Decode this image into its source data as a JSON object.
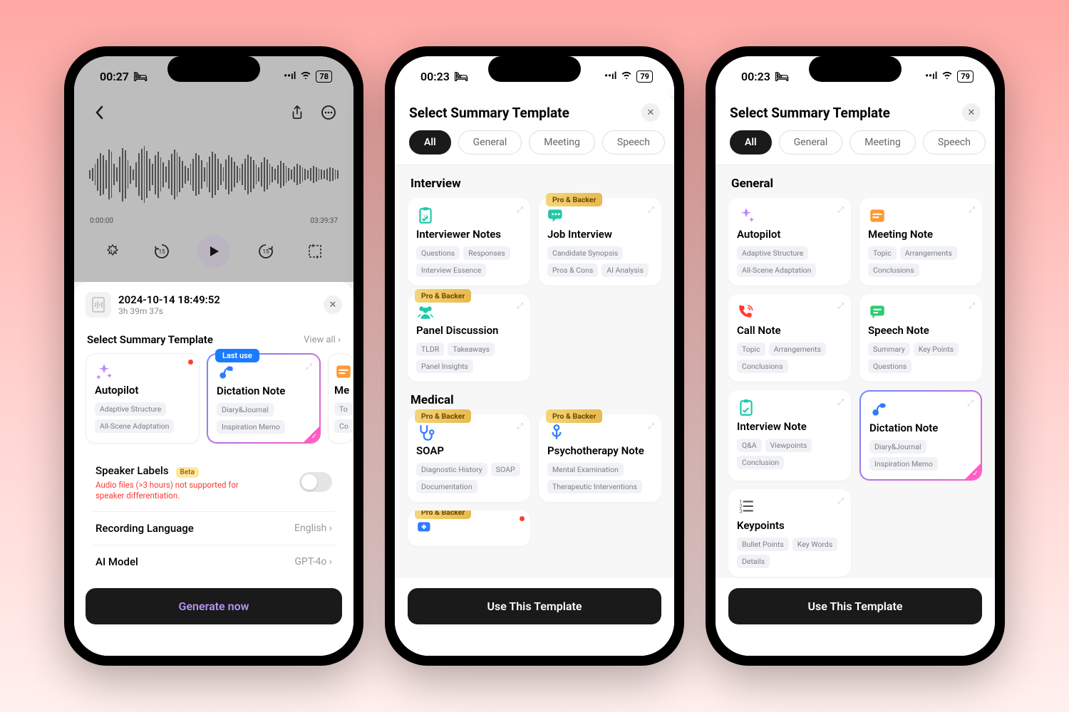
{
  "status": {
    "time1": "00:27",
    "time2": "00:23",
    "battery1": "78",
    "battery2": "79"
  },
  "phone1": {
    "waveform_start": "0:00:00",
    "waveform_end": "03:39:37",
    "rec_title": "2024-10-14 18:49:52",
    "rec_duration": "3h 39m 37s",
    "section": "Select Summary Template",
    "view_all": "View all",
    "autopilot": {
      "name": "Autopilot",
      "tag1": "Adaptive Structure",
      "tag2": "All-Scene Adaptation"
    },
    "dictation": {
      "badge": "Last use",
      "name": "Dictation Note",
      "tag1": "Diary&Journal",
      "tag2": "Inspiration Memo"
    },
    "meeting_cut": {
      "name": "Me",
      "tag1": "To",
      "tag2": "Co"
    },
    "speaker": {
      "label": "Speaker Labels",
      "beta": "Beta",
      "warn": "Audio files (>3 hours) not supported for speaker differentiation."
    },
    "lang": {
      "label": "Recording Language",
      "value": "English"
    },
    "model": {
      "label": "AI Model",
      "value": "GPT-4o"
    },
    "cta": "Generate now"
  },
  "sheet_common": {
    "title": "Select Summary Template",
    "pills": {
      "all": "All",
      "general": "General",
      "meeting": "Meeting",
      "speech": "Speech"
    },
    "pro_badge": "Pro & Backer",
    "cta": "Use This Template"
  },
  "phone2": {
    "cat_interview": "Interview",
    "interviewer": {
      "name": "Interviewer Notes",
      "t1": "Questions",
      "t2": "Responses",
      "t3": "Interview Essence"
    },
    "job": {
      "name": "Job Interview",
      "t1": "Candidate Synopsis",
      "t2": "Pros & Cons",
      "t3": "AI Analysis"
    },
    "panel": {
      "name": "Panel Discussion",
      "t1": "TLDR",
      "t2": "Takeaways",
      "t3": "Panel Insights"
    },
    "cat_medical": "Medical",
    "soap": {
      "name": "SOAP",
      "t1": "Diagnostic History",
      "t2": "SOAP",
      "t3": "Documentation"
    },
    "psych": {
      "name": "Psychotherapy Note",
      "t1": "Mental Examination",
      "t2": "Therapeutic Interventions"
    }
  },
  "phone3": {
    "cat_general": "General",
    "autopilot": {
      "name": "Autopilot",
      "t1": "Adaptive Structure",
      "t2": "All-Scene Adaptation"
    },
    "meeting": {
      "name": "Meeting Note",
      "t1": "Topic",
      "t2": "Arrangements",
      "t3": "Conclusions"
    },
    "call": {
      "name": "Call Note",
      "t1": "Topic",
      "t2": "Arrangements",
      "t3": "Conclusions"
    },
    "speech": {
      "name": "Speech Note",
      "t1": "Summary",
      "t2": "Key Points",
      "t3": "Questions"
    },
    "interview": {
      "name": "Interview Note",
      "t1": "Q&A",
      "t2": "Viewpoints",
      "t3": "Conclusion"
    },
    "dictation": {
      "name": "Dictation Note",
      "t1": "Diary&Journal",
      "t2": "Inspiration Memo"
    },
    "keypoints": {
      "name": "Keypoints",
      "t1": "Bullet Points",
      "t2": "Key Words",
      "t3": "Details"
    }
  }
}
